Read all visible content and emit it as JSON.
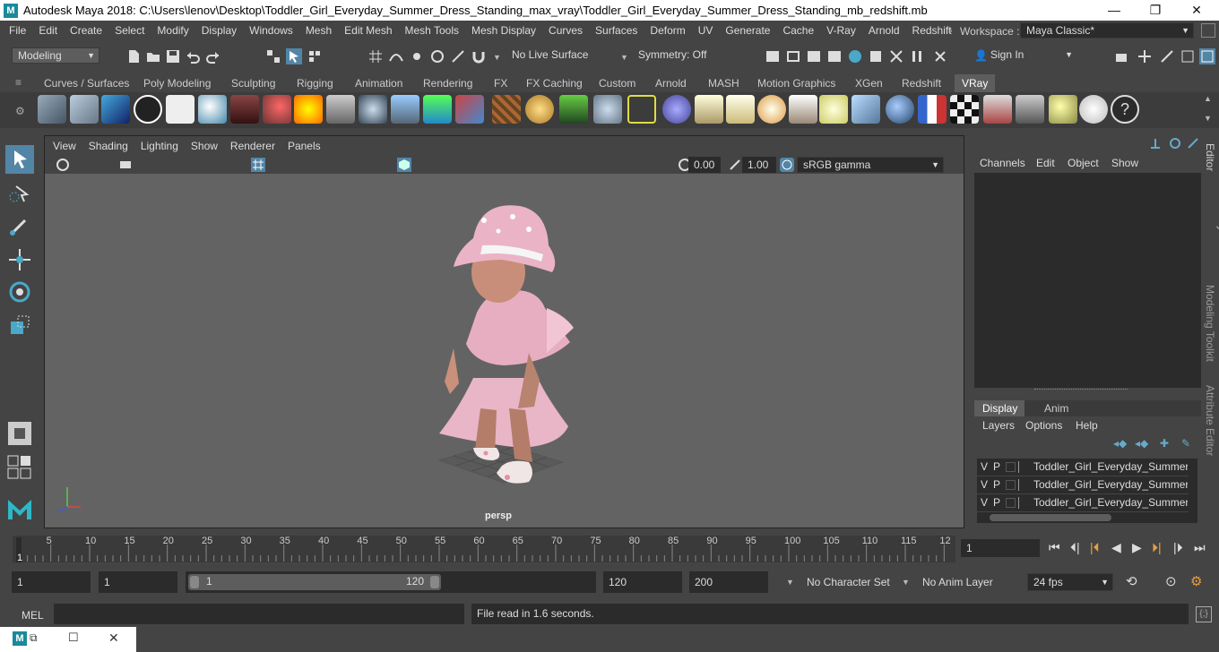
{
  "window": {
    "title": "Autodesk Maya 2018: C:\\Users\\lenov\\Desktop\\Toddler_Girl_Everyday_Summer_Dress_Standing_max_vray\\Toddler_Girl_Everyday_Summer_Dress_Standing_mb_redshift.mb",
    "minimize": "—",
    "maximize": "❐",
    "close": "✕"
  },
  "menubar": {
    "items": [
      "File",
      "Edit",
      "Create",
      "Select",
      "Modify",
      "Display",
      "Windows",
      "Mesh",
      "Edit Mesh",
      "Mesh Tools",
      "Mesh Display",
      "Curves",
      "Surfaces",
      "Deform",
      "UV",
      "Generate",
      "Cache",
      "V-Ray",
      "Arnold",
      "Redshift"
    ],
    "workspace_label": "Workspace :",
    "workspace_value": "Maya Classic*"
  },
  "statusline": {
    "mode": "Modeling",
    "live_surface": "No Live Surface",
    "symmetry": "Symmetry: Off",
    "sign_in": "Sign In"
  },
  "shelf_tabs": {
    "tabs": [
      "Curves / Surfaces",
      "Poly Modeling",
      "Sculpting",
      "Rigging",
      "Animation",
      "Rendering",
      "FX",
      "FX Caching",
      "Custom",
      "Arnold",
      "MASH",
      "Motion Graphics",
      "XGen",
      "Redshift",
      "VRay"
    ],
    "active": "VRay"
  },
  "viewport": {
    "menu": [
      "View",
      "Shading",
      "Lighting",
      "Show",
      "Renderer",
      "Panels"
    ],
    "exposure": "0.00",
    "gamma": "1.00",
    "color_space": "sRGB gamma",
    "camera_label": "persp"
  },
  "channel_box": {
    "menu": [
      "Channels",
      "Edit",
      "Object",
      "Show"
    ]
  },
  "layer_editor": {
    "tabs": [
      "Display",
      "Anim"
    ],
    "active_tab": "Display",
    "menu": [
      "Layers",
      "Options",
      "Help"
    ],
    "layers": [
      {
        "v": "V",
        "p": "P",
        "name": "Toddler_Girl_Everyday_Summer_D"
      },
      {
        "v": "V",
        "p": "P",
        "name": "Toddler_Girl_Everyday_Summer_D"
      },
      {
        "v": "V",
        "p": "P",
        "name": "Toddler_Girl_Everyday_Summer_D"
      }
    ]
  },
  "side_tabs": [
    "Channel Box / Layer Editor",
    "Modeling Toolkit",
    "Attribute Editor"
  ],
  "timeline": {
    "start_frame": "1",
    "ticks": [
      "5",
      "10",
      "15",
      "20",
      "25",
      "30",
      "35",
      "40",
      "45",
      "50",
      "55",
      "60",
      "65",
      "70",
      "75",
      "80",
      "85",
      "90",
      "95",
      "100",
      "105",
      "110",
      "115",
      "12"
    ],
    "current_frame": "1"
  },
  "range": {
    "start": "1",
    "playback_start": "1",
    "slider_start": "1",
    "slider_end": "120",
    "playback_end": "120",
    "end": "200",
    "character_set": "No Character Set",
    "anim_layer": "No Anim Layer",
    "fps": "24 fps"
  },
  "command_line": {
    "label": "MEL",
    "message": "File read in  1.6 seconds."
  },
  "colors": {
    "accent": "#5285a6",
    "panel": "#444444",
    "field": "#2b2b2b",
    "scene": "#636363"
  }
}
